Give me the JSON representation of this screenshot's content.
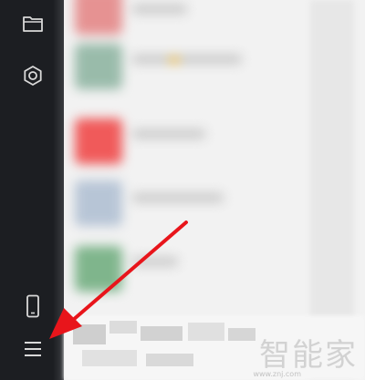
{
  "sidebar": {
    "items": [
      {
        "name": "folder",
        "icon": "folder-icon"
      },
      {
        "name": "settings",
        "icon": "gear-icon"
      },
      {
        "name": "phone",
        "icon": "phone-icon"
      },
      {
        "name": "menu",
        "icon": "hamburger-menu-icon"
      }
    ]
  },
  "annotation": {
    "arrow_color": "#e8151b",
    "points_to": "hamburger-menu-icon"
  },
  "watermark": {
    "text": "智能家",
    "sub": "www.znj.com"
  },
  "colors": {
    "sidebar_bg": "#1c1e22",
    "icon": "#d9d9d9",
    "red_tile": "#f05a5a"
  }
}
